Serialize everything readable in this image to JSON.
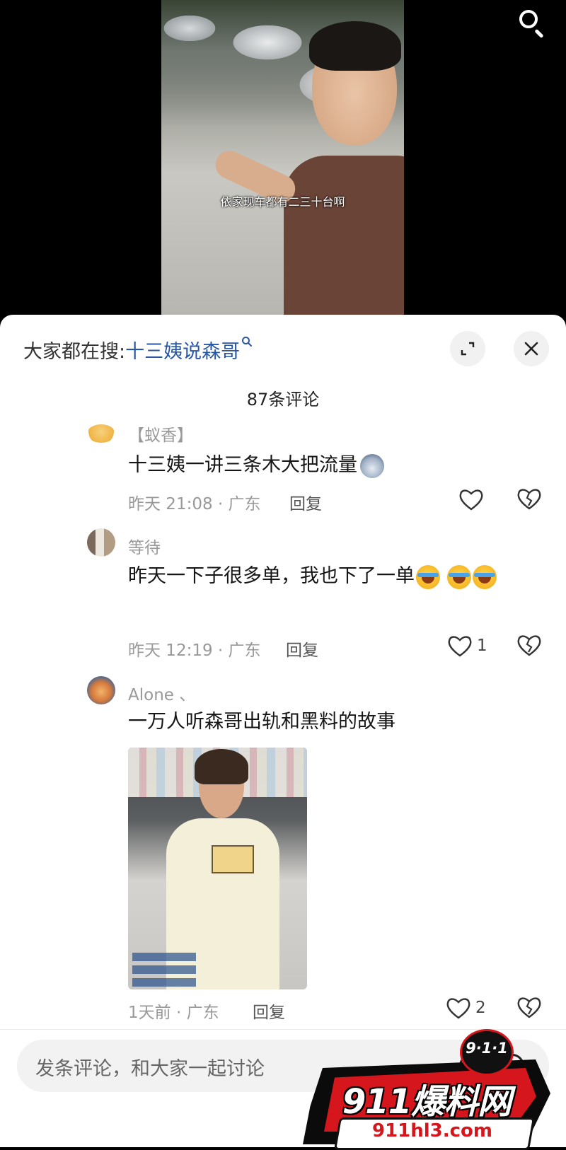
{
  "video": {
    "subtitle": "依家现车都有二三十台啊"
  },
  "sheet": {
    "search_prefix": "大家都在搜:",
    "search_term": "十三姨说森哥",
    "comment_count": "87条评论"
  },
  "comments": [
    {
      "username": "【蚁香】",
      "text": "十三姨一讲三条木大把流量",
      "emoji": "wolf-emoji",
      "meta": "昨天 21:08 · 广东",
      "reply": "回复",
      "likes": ""
    },
    {
      "username": "等待",
      "text": "昨天一下子很多单，我也下了一单",
      "emoji": "laugh-cry-emoji",
      "meta": "昨天 12:19 · 广东",
      "reply": "回复",
      "likes": "1"
    },
    {
      "username": "Alone 、",
      "text": "一万人听森哥出轨和黑料的故事",
      "meta": "1天前 · 广东",
      "reply": "回复",
      "likes": "2"
    }
  ],
  "input": {
    "placeholder": "发条评论，和大家一起讨论"
  },
  "watermark": {
    "main": "911爆料网",
    "url": "911hl3.com",
    "badge": "9·1·1"
  },
  "icons": {
    "top": "search-icon",
    "expand": "expand-icon",
    "close": "close-icon",
    "like": "heart-icon",
    "dislike": "broken-heart-icon"
  }
}
